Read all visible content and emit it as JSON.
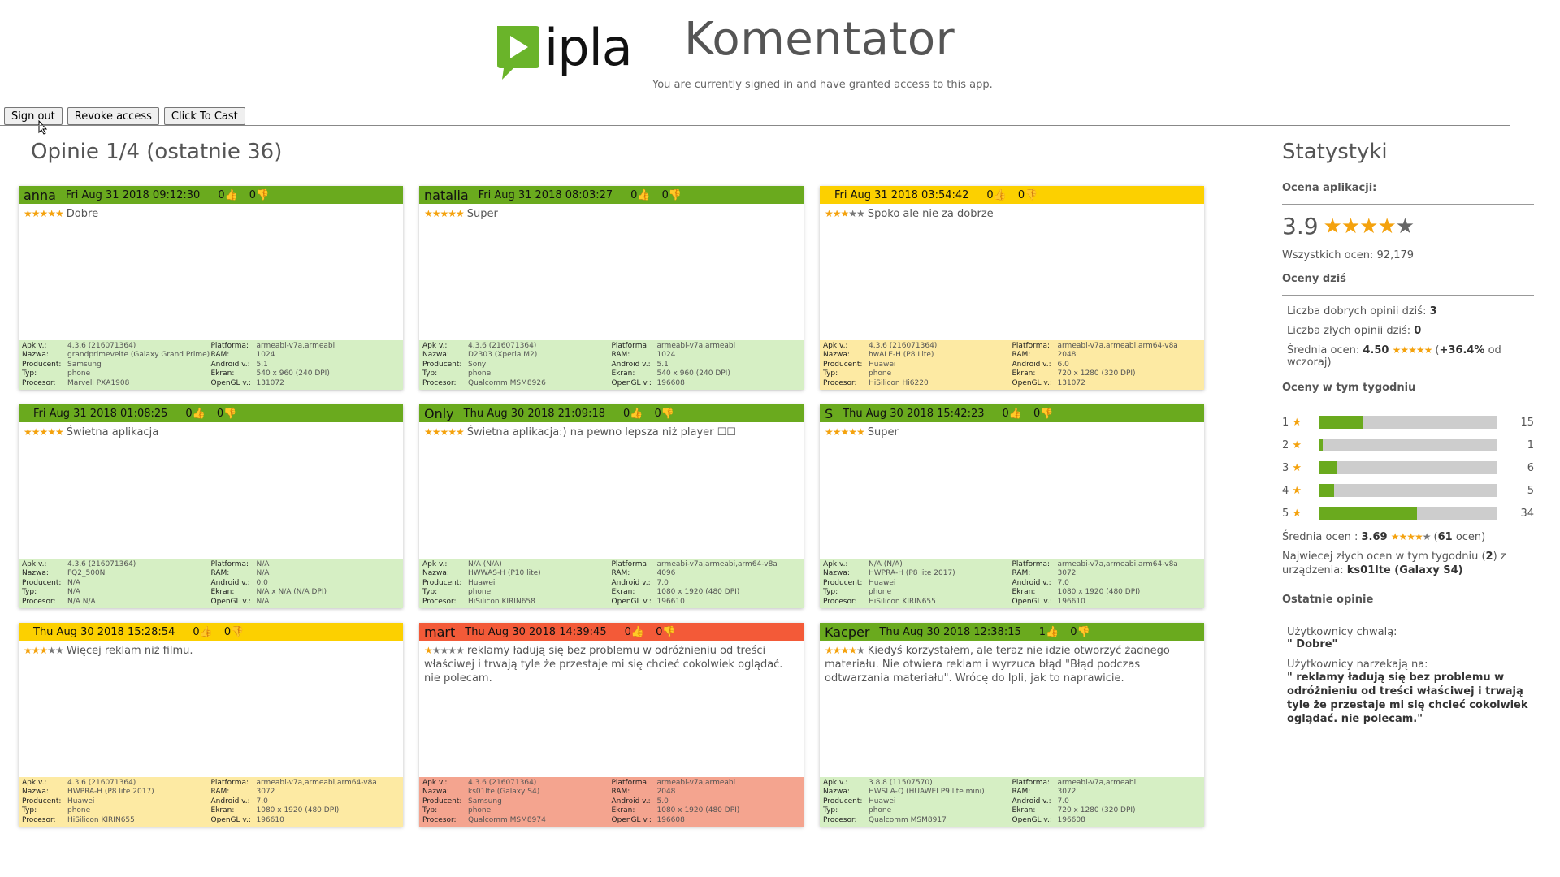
{
  "header": {
    "logo_text": "ipla",
    "title": "Komentator",
    "signed_message": "You are currently signed in and have granted access to this app.",
    "buttons": {
      "sign_out": "Sign out",
      "revoke": "Revoke access",
      "cast": "Click To Cast"
    }
  },
  "section_title": "Opinie 1/4 (ostatnie 36)",
  "info_labels": {
    "apk": "Apk v.:",
    "name": "Nazwa:",
    "producer": "Producent:",
    "type": "Typ:",
    "cpu": "Procesor:",
    "platform": "Platforma:",
    "ram": "RAM:",
    "android": "Android v.:",
    "screen": "Ekran:",
    "opengl": "OpenGL v.:"
  },
  "reviews": [
    {
      "user": "anna",
      "date": "Fri Aug 31 2018 09:12:30",
      "likes": "0",
      "dislikes": "0",
      "rating": 5,
      "text": "Dobre",
      "color": "green",
      "apk": "4.3.6 (216071364)",
      "name": "grandprimevelte (Galaxy Grand Prime)",
      "producer": "Samsung",
      "type": "phone",
      "cpu": "Marvell PXA1908",
      "platform": "armeabi-v7a,armeabi",
      "ram": "1024",
      "android": "5.1",
      "screen": "540 x 960 (240 DPI)",
      "opengl": "131072"
    },
    {
      "user": "natalia",
      "date": "Fri Aug 31 2018 08:03:27",
      "likes": "0",
      "dislikes": "0",
      "rating": 5,
      "text": "Super",
      "color": "green",
      "apk": "4.3.6 (216071364)",
      "name": "D2303 (Xperia M2)",
      "producer": "Sony",
      "type": "phone",
      "cpu": "Qualcomm MSM8926",
      "platform": "armeabi-v7a,armeabi",
      "ram": "1024",
      "android": "5.1",
      "screen": "540 x 960 (240 DPI)",
      "opengl": "196608"
    },
    {
      "user": "",
      "date": "Fri Aug 31 2018 03:54:42",
      "likes": "0",
      "dislikes": "0",
      "rating": 3,
      "text": "Spoko ale nie za dobrze",
      "color": "yellow",
      "apk": "4.3.6 (216071364)",
      "name": "hwALE-H (P8 Lite)",
      "producer": "Huawei",
      "type": "phone",
      "cpu": "HiSilicon Hi6220",
      "platform": "armeabi-v7a,armeabi,arm64-v8a",
      "ram": "2048",
      "android": "6.0",
      "screen": "720 x 1280 (320 DPI)",
      "opengl": "131072"
    },
    {
      "user": "",
      "date": "Fri Aug 31 2018 01:08:25",
      "likes": "0",
      "dislikes": "0",
      "rating": 5,
      "text": "Świetna aplikacja",
      "color": "green",
      "apk": "4.3.6 (216071364)",
      "name": "FQ2_500N",
      "producer": "N/A",
      "type": "N/A",
      "cpu": "N/A N/A",
      "platform": "N/A",
      "ram": "N/A",
      "android": "0.0",
      "screen": "N/A x N/A (N/A DPI)",
      "opengl": "N/A"
    },
    {
      "user": "Only",
      "date": "Thu Aug 30 2018 21:09:18",
      "likes": "0",
      "dislikes": "0",
      "rating": 5,
      "text": "Świetna aplikacja:) na pewno lepsza niż player ☐☐",
      "color": "green",
      "apk": "N/A (N/A)",
      "name": "HWWAS-H (P10 lite)",
      "producer": "Huawei",
      "type": "phone",
      "cpu": "HiSilicon KIRIN658",
      "platform": "armeabi-v7a,armeabi,arm64-v8a",
      "ram": "4096",
      "android": "7.0",
      "screen": "1080 x 1920 (480 DPI)",
      "opengl": "196610"
    },
    {
      "user": "S",
      "date": "Thu Aug 30 2018 15:42:23",
      "likes": "0",
      "dislikes": "0",
      "rating": 5,
      "text": "Super",
      "color": "green",
      "apk": "N/A (N/A)",
      "name": "HWPRA-H (P8 lite 2017)",
      "producer": "Huawei",
      "type": "phone",
      "cpu": "HiSilicon KIRIN655",
      "platform": "armeabi-v7a,armeabi,arm64-v8a",
      "ram": "3072",
      "android": "7.0",
      "screen": "1080 x 1920 (480 DPI)",
      "opengl": "196610"
    },
    {
      "user": "",
      "date": "Thu Aug 30 2018 15:28:54",
      "likes": "0",
      "dislikes": "0",
      "rating": 3,
      "text": "Więcej reklam niż filmu.",
      "color": "yellow",
      "apk": "4.3.6 (216071364)",
      "name": "HWPRA-H (P8 lite 2017)",
      "producer": "Huawei",
      "type": "phone",
      "cpu": "HiSilicon KIRIN655",
      "platform": "armeabi-v7a,armeabi,arm64-v8a",
      "ram": "3072",
      "android": "7.0",
      "screen": "1080 x 1920 (480 DPI)",
      "opengl": "196610"
    },
    {
      "user": "mart",
      "date": "Thu Aug 30 2018 14:39:45",
      "likes": "0",
      "dislikes": "0",
      "rating": 1,
      "text": "reklamy ładują się bez problemu w odróżnieniu od treści właściwej i trwają tyle że przestaje mi się chcieć cokolwiek oglądać. nie polecam.",
      "color": "red",
      "apk": "4.3.6 (216071364)",
      "name": "ks01lte (Galaxy S4)",
      "producer": "Samsung",
      "type": "phone",
      "cpu": "Qualcomm MSM8974",
      "platform": "armeabi-v7a,armeabi",
      "ram": "2048",
      "android": "5.0",
      "screen": "1080 x 1920 (480 DPI)",
      "opengl": "196608"
    },
    {
      "user": "Kacper",
      "date": "Thu Aug 30 2018 12:38:15",
      "likes": "1",
      "dislikes": "0",
      "rating": 4,
      "text": "Kiedyś korzystałem, ale teraz nie idzie otworzyć żadnego materiału. Nie otwiera reklam i wyrzuca błąd \"Błąd podczas odtwarzania materiału\". Wrócę do Ipli, jak to naprawicie.",
      "color": "green",
      "apk": "3.8.8 (11507570)",
      "name": "HWSLA-Q (HUAWEI P9 lite mini)",
      "producer": "Huawei",
      "type": "phone",
      "cpu": "Qualcomm MSM8917",
      "platform": "armeabi-v7a,armeabi",
      "ram": "3072",
      "android": "7.0",
      "screen": "720 x 1280 (320 DPI)",
      "opengl": "196608"
    }
  ],
  "stats": {
    "title": "Statystyki",
    "app_rating_label": "Ocena aplikacji:",
    "rating_value": "3.9",
    "rating_stars": 4,
    "total_label": "Wszystkich ocen: 92,179",
    "today_label": "Oceny dziś",
    "good_today_prefix": "Liczba dobrych opinii dziś: ",
    "good_today": "3",
    "bad_today_prefix": "Liczba złych opinii dziś: ",
    "bad_today": "0",
    "avg_prefix": "Średnia ocen: ",
    "avg_value": "4.50",
    "avg_change": "+36.4%",
    "avg_suffix": " od wczoraj)",
    "week_label": "Oceny w tym tygodniu",
    "week_bars": [
      {
        "label": "1",
        "count": "15",
        "value": 15
      },
      {
        "label": "2",
        "count": "1",
        "value": 1
      },
      {
        "label": "3",
        "count": "6",
        "value": 6
      },
      {
        "label": "4",
        "count": "5",
        "value": 5
      },
      {
        "label": "5",
        "count": "34",
        "value": 34
      }
    ],
    "week_max": 62,
    "week_avg_prefix": "Średnia ocen : ",
    "week_avg": "3.69",
    "week_count": "61",
    "week_count_suffix": " ocen)",
    "worst_device_text": "Najwiecej złych ocen w tym tygodniu (",
    "worst_device_count": "2",
    "worst_device_mid": ") z urządzenia: ",
    "worst_device": "ks01lte (Galaxy S4)",
    "recent_label": "Ostatnie opinie",
    "praise_label": "Użytkownicy chwalą:",
    "praise_text": "\" Dobre\"",
    "complain_label": "Użytkownicy narzekają na:",
    "complain_text": "\" reklamy ładują się bez problemu w odróżnieniu od treści właściwej i trwają tyle że przestaje mi się chcieć cokolwiek oglądać. nie polecam.\""
  },
  "colors": {
    "green": "#6aaa1e",
    "yellow": "#fcd000",
    "red": "#f35a38"
  }
}
